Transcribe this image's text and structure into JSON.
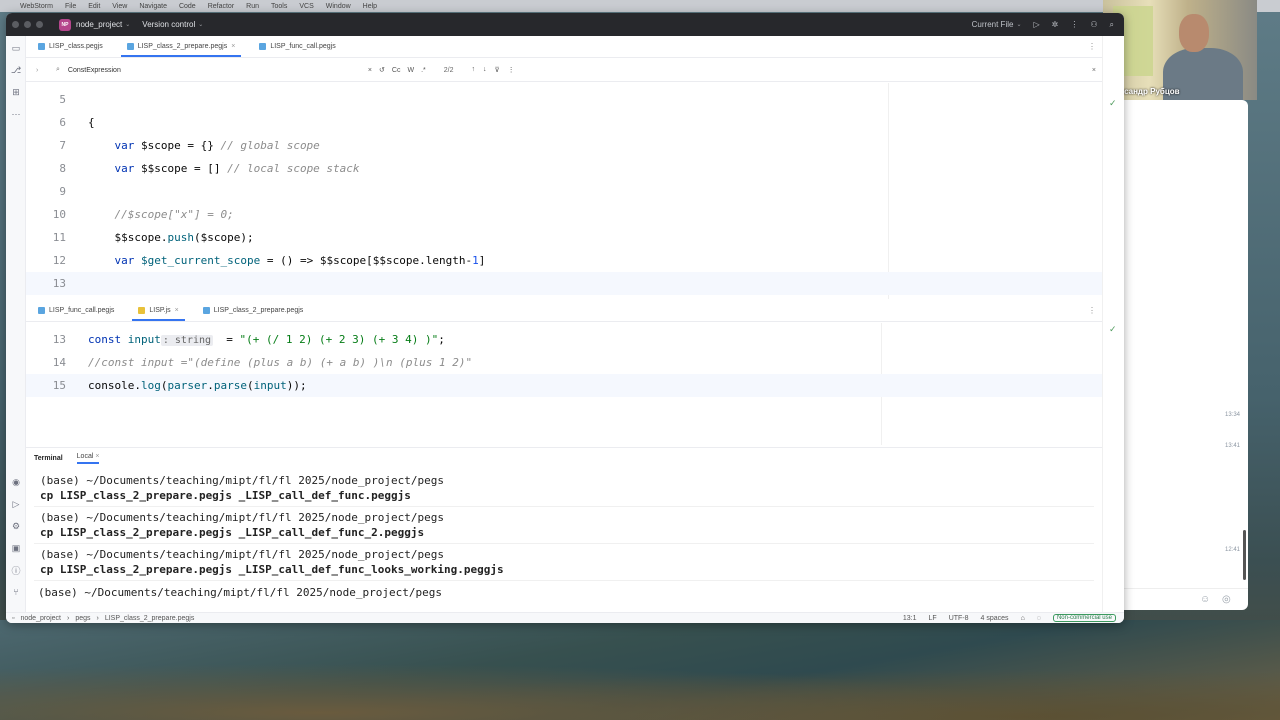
{
  "menubar": {
    "app_name": "WebStorm",
    "items": [
      "File",
      "Edit",
      "View",
      "Navigate",
      "Code",
      "Refactor",
      "Run",
      "Tools",
      "VCS",
      "Window",
      "Help"
    ]
  },
  "titlebar": {
    "project_badge": "NP",
    "project_name": "node_project",
    "vcs_label": "Version control",
    "run_config": "Current File"
  },
  "top_tabs": [
    {
      "label": "LISP_class.pegjs",
      "active": false
    },
    {
      "label": "LISP_class_2_prepare.pegjs",
      "active": true
    },
    {
      "label": "LISP_func_call.pegjs",
      "active": false
    }
  ],
  "findbar": {
    "query": "ConstExpression",
    "case_label": "Cc",
    "word_label": "W",
    "regex_label": ".*",
    "match_count": "2/2"
  },
  "top_code": [
    {
      "num": "5",
      "parts": []
    },
    {
      "num": "6",
      "parts": [
        {
          "t": "{",
          "c": ""
        }
      ]
    },
    {
      "num": "7",
      "parts": [
        {
          "t": "    ",
          "c": ""
        },
        {
          "t": "var",
          "c": "kw"
        },
        {
          "t": " $scope = {} ",
          "c": ""
        },
        {
          "t": "// global scope",
          "c": "cm"
        }
      ]
    },
    {
      "num": "8",
      "parts": [
        {
          "t": "    ",
          "c": ""
        },
        {
          "t": "var",
          "c": "kw"
        },
        {
          "t": " $$scope = [] ",
          "c": ""
        },
        {
          "t": "// local scope stack",
          "c": "cm"
        }
      ]
    },
    {
      "num": "9",
      "parts": []
    },
    {
      "num": "10",
      "parts": [
        {
          "t": "    ",
          "c": ""
        },
        {
          "t": "//$scope[\"x\"] = 0;",
          "c": "cm"
        }
      ]
    },
    {
      "num": "11",
      "parts": [
        {
          "t": "    $$scope.",
          "c": ""
        },
        {
          "t": "push",
          "c": "fn"
        },
        {
          "t": "($scope);",
          "c": ""
        }
      ]
    },
    {
      "num": "12",
      "parts": [
        {
          "t": "    ",
          "c": ""
        },
        {
          "t": "var",
          "c": "kw"
        },
        {
          "t": " ",
          "c": ""
        },
        {
          "t": "$get_current_scope",
          "c": "fn"
        },
        {
          "t": " = () => $$scope[$$scope.length-",
          "c": ""
        },
        {
          "t": "1",
          "c": "num"
        },
        {
          "t": "]",
          "c": ""
        }
      ]
    },
    {
      "num": "13",
      "parts": []
    }
  ],
  "bottom_tabs": [
    {
      "label": "LISP_func_call.pegjs",
      "active": false
    },
    {
      "label": "LISP.js",
      "active": true
    },
    {
      "label": "LISP_class_2_prepare.pegjs",
      "active": false
    }
  ],
  "bottom_code": [
    {
      "num": "13",
      "parts": [
        {
          "t": "const",
          "c": "kw"
        },
        {
          "t": " ",
          "c": ""
        },
        {
          "t": "input",
          "c": "fn"
        },
        {
          "t": ": string",
          "c": "hint"
        },
        {
          "t": "  = ",
          "c": ""
        },
        {
          "t": "\"(+ (/ 1 2) (+ 2 3) (+ 3 4) )\"",
          "c": "str"
        },
        {
          "t": ";",
          "c": ""
        }
      ]
    },
    {
      "num": "14",
      "parts": [
        {
          "t": "//const input =\"(define (plus a b) (+ a b) )\\n (plus 1 2)\"",
          "c": "cm"
        }
      ]
    },
    {
      "num": "15",
      "parts": [
        {
          "t": "console.",
          "c": ""
        },
        {
          "t": "log",
          "c": "fn"
        },
        {
          "t": "(",
          "c": ""
        },
        {
          "t": "parser",
          "c": "fn"
        },
        {
          "t": ".",
          "c": ""
        },
        {
          "t": "parse",
          "c": "fn"
        },
        {
          "t": "(",
          "c": ""
        },
        {
          "t": "input",
          "c": "fn"
        },
        {
          "t": "));",
          "c": ""
        }
      ]
    }
  ],
  "terminal": {
    "title": "Terminal",
    "tab": "Local",
    "lines": [
      {
        "text": "(base) ~/Documents/teaching/mipt/fl/fl 2025/node_project/pegs",
        "cmd": false
      },
      {
        "text": "cp LISP_class_2_prepare.pegjs _LISP_call_def_func.peggjs",
        "cmd": true
      },
      {
        "text": "(base) ~/Documents/teaching/mipt/fl/fl 2025/node_project/pegs",
        "cmd": false
      },
      {
        "text": "cp LISP_class_2_prepare.pegjs _LISP_call_def_func_2.peggjs",
        "cmd": true
      },
      {
        "text": "(base) ~/Documents/teaching/mipt/fl/fl 2025/node_project/pegs",
        "cmd": false
      },
      {
        "text": "cp LISP_class_2_prepare.pegjs _LISP_call_def_func_looks_working.peggjs",
        "cmd": true
      },
      {
        "text": "(base) ~/Documents/teaching/mipt/fl/fl 2025/node_project/pegs",
        "cmd": false
      }
    ]
  },
  "statusbar": {
    "crumbs": [
      "node_project",
      "pegs",
      "LISP_class_2_prepare.pegjs"
    ],
    "position": "13:1",
    "line_sep": "LF",
    "encoding": "UTF-8",
    "indent": "4 spaces",
    "license": "Non-commercial use"
  },
  "chat": {
    "timestamps": [
      "13:34",
      "13:41",
      "12:41"
    ]
  },
  "video": {
    "name": "Александр Рубцов"
  }
}
